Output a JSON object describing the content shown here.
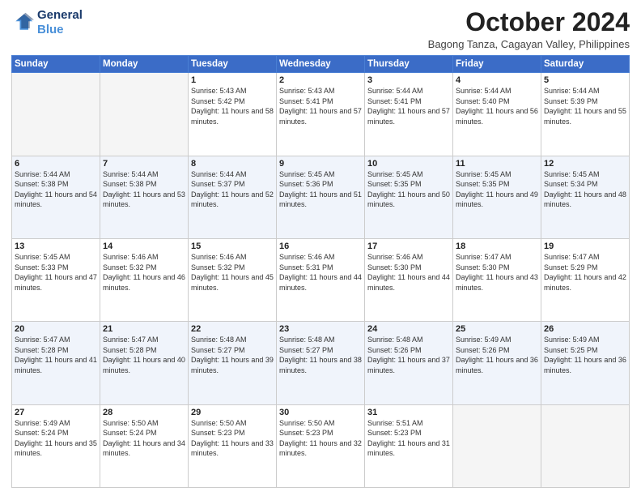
{
  "header": {
    "logo_line1": "General",
    "logo_line2": "Blue",
    "month_title": "October 2024",
    "subtitle": "Bagong Tanza, Cagayan Valley, Philippines"
  },
  "weekdays": [
    "Sunday",
    "Monday",
    "Tuesday",
    "Wednesday",
    "Thursday",
    "Friday",
    "Saturday"
  ],
  "weeks": [
    [
      {
        "day": "",
        "sunrise": "",
        "sunset": "",
        "daylight": ""
      },
      {
        "day": "",
        "sunrise": "",
        "sunset": "",
        "daylight": ""
      },
      {
        "day": "1",
        "sunrise": "Sunrise: 5:43 AM",
        "sunset": "Sunset: 5:42 PM",
        "daylight": "Daylight: 11 hours and 58 minutes."
      },
      {
        "day": "2",
        "sunrise": "Sunrise: 5:43 AM",
        "sunset": "Sunset: 5:41 PM",
        "daylight": "Daylight: 11 hours and 57 minutes."
      },
      {
        "day": "3",
        "sunrise": "Sunrise: 5:44 AM",
        "sunset": "Sunset: 5:41 PM",
        "daylight": "Daylight: 11 hours and 57 minutes."
      },
      {
        "day": "4",
        "sunrise": "Sunrise: 5:44 AM",
        "sunset": "Sunset: 5:40 PM",
        "daylight": "Daylight: 11 hours and 56 minutes."
      },
      {
        "day": "5",
        "sunrise": "Sunrise: 5:44 AM",
        "sunset": "Sunset: 5:39 PM",
        "daylight": "Daylight: 11 hours and 55 minutes."
      }
    ],
    [
      {
        "day": "6",
        "sunrise": "Sunrise: 5:44 AM",
        "sunset": "Sunset: 5:38 PM",
        "daylight": "Daylight: 11 hours and 54 minutes."
      },
      {
        "day": "7",
        "sunrise": "Sunrise: 5:44 AM",
        "sunset": "Sunset: 5:38 PM",
        "daylight": "Daylight: 11 hours and 53 minutes."
      },
      {
        "day": "8",
        "sunrise": "Sunrise: 5:44 AM",
        "sunset": "Sunset: 5:37 PM",
        "daylight": "Daylight: 11 hours and 52 minutes."
      },
      {
        "day": "9",
        "sunrise": "Sunrise: 5:45 AM",
        "sunset": "Sunset: 5:36 PM",
        "daylight": "Daylight: 11 hours and 51 minutes."
      },
      {
        "day": "10",
        "sunrise": "Sunrise: 5:45 AM",
        "sunset": "Sunset: 5:35 PM",
        "daylight": "Daylight: 11 hours and 50 minutes."
      },
      {
        "day": "11",
        "sunrise": "Sunrise: 5:45 AM",
        "sunset": "Sunset: 5:35 PM",
        "daylight": "Daylight: 11 hours and 49 minutes."
      },
      {
        "day": "12",
        "sunrise": "Sunrise: 5:45 AM",
        "sunset": "Sunset: 5:34 PM",
        "daylight": "Daylight: 11 hours and 48 minutes."
      }
    ],
    [
      {
        "day": "13",
        "sunrise": "Sunrise: 5:45 AM",
        "sunset": "Sunset: 5:33 PM",
        "daylight": "Daylight: 11 hours and 47 minutes."
      },
      {
        "day": "14",
        "sunrise": "Sunrise: 5:46 AM",
        "sunset": "Sunset: 5:32 PM",
        "daylight": "Daylight: 11 hours and 46 minutes."
      },
      {
        "day": "15",
        "sunrise": "Sunrise: 5:46 AM",
        "sunset": "Sunset: 5:32 PM",
        "daylight": "Daylight: 11 hours and 45 minutes."
      },
      {
        "day": "16",
        "sunrise": "Sunrise: 5:46 AM",
        "sunset": "Sunset: 5:31 PM",
        "daylight": "Daylight: 11 hours and 44 minutes."
      },
      {
        "day": "17",
        "sunrise": "Sunrise: 5:46 AM",
        "sunset": "Sunset: 5:30 PM",
        "daylight": "Daylight: 11 hours and 44 minutes."
      },
      {
        "day": "18",
        "sunrise": "Sunrise: 5:47 AM",
        "sunset": "Sunset: 5:30 PM",
        "daylight": "Daylight: 11 hours and 43 minutes."
      },
      {
        "day": "19",
        "sunrise": "Sunrise: 5:47 AM",
        "sunset": "Sunset: 5:29 PM",
        "daylight": "Daylight: 11 hours and 42 minutes."
      }
    ],
    [
      {
        "day": "20",
        "sunrise": "Sunrise: 5:47 AM",
        "sunset": "Sunset: 5:28 PM",
        "daylight": "Daylight: 11 hours and 41 minutes."
      },
      {
        "day": "21",
        "sunrise": "Sunrise: 5:47 AM",
        "sunset": "Sunset: 5:28 PM",
        "daylight": "Daylight: 11 hours and 40 minutes."
      },
      {
        "day": "22",
        "sunrise": "Sunrise: 5:48 AM",
        "sunset": "Sunset: 5:27 PM",
        "daylight": "Daylight: 11 hours and 39 minutes."
      },
      {
        "day": "23",
        "sunrise": "Sunrise: 5:48 AM",
        "sunset": "Sunset: 5:27 PM",
        "daylight": "Daylight: 11 hours and 38 minutes."
      },
      {
        "day": "24",
        "sunrise": "Sunrise: 5:48 AM",
        "sunset": "Sunset: 5:26 PM",
        "daylight": "Daylight: 11 hours and 37 minutes."
      },
      {
        "day": "25",
        "sunrise": "Sunrise: 5:49 AM",
        "sunset": "Sunset: 5:26 PM",
        "daylight": "Daylight: 11 hours and 36 minutes."
      },
      {
        "day": "26",
        "sunrise": "Sunrise: 5:49 AM",
        "sunset": "Sunset: 5:25 PM",
        "daylight": "Daylight: 11 hours and 36 minutes."
      }
    ],
    [
      {
        "day": "27",
        "sunrise": "Sunrise: 5:49 AM",
        "sunset": "Sunset: 5:24 PM",
        "daylight": "Daylight: 11 hours and 35 minutes."
      },
      {
        "day": "28",
        "sunrise": "Sunrise: 5:50 AM",
        "sunset": "Sunset: 5:24 PM",
        "daylight": "Daylight: 11 hours and 34 minutes."
      },
      {
        "day": "29",
        "sunrise": "Sunrise: 5:50 AM",
        "sunset": "Sunset: 5:23 PM",
        "daylight": "Daylight: 11 hours and 33 minutes."
      },
      {
        "day": "30",
        "sunrise": "Sunrise: 5:50 AM",
        "sunset": "Sunset: 5:23 PM",
        "daylight": "Daylight: 11 hours and 32 minutes."
      },
      {
        "day": "31",
        "sunrise": "Sunrise: 5:51 AM",
        "sunset": "Sunset: 5:23 PM",
        "daylight": "Daylight: 11 hours and 31 minutes."
      },
      {
        "day": "",
        "sunrise": "",
        "sunset": "",
        "daylight": ""
      },
      {
        "day": "",
        "sunrise": "",
        "sunset": "",
        "daylight": ""
      }
    ]
  ]
}
